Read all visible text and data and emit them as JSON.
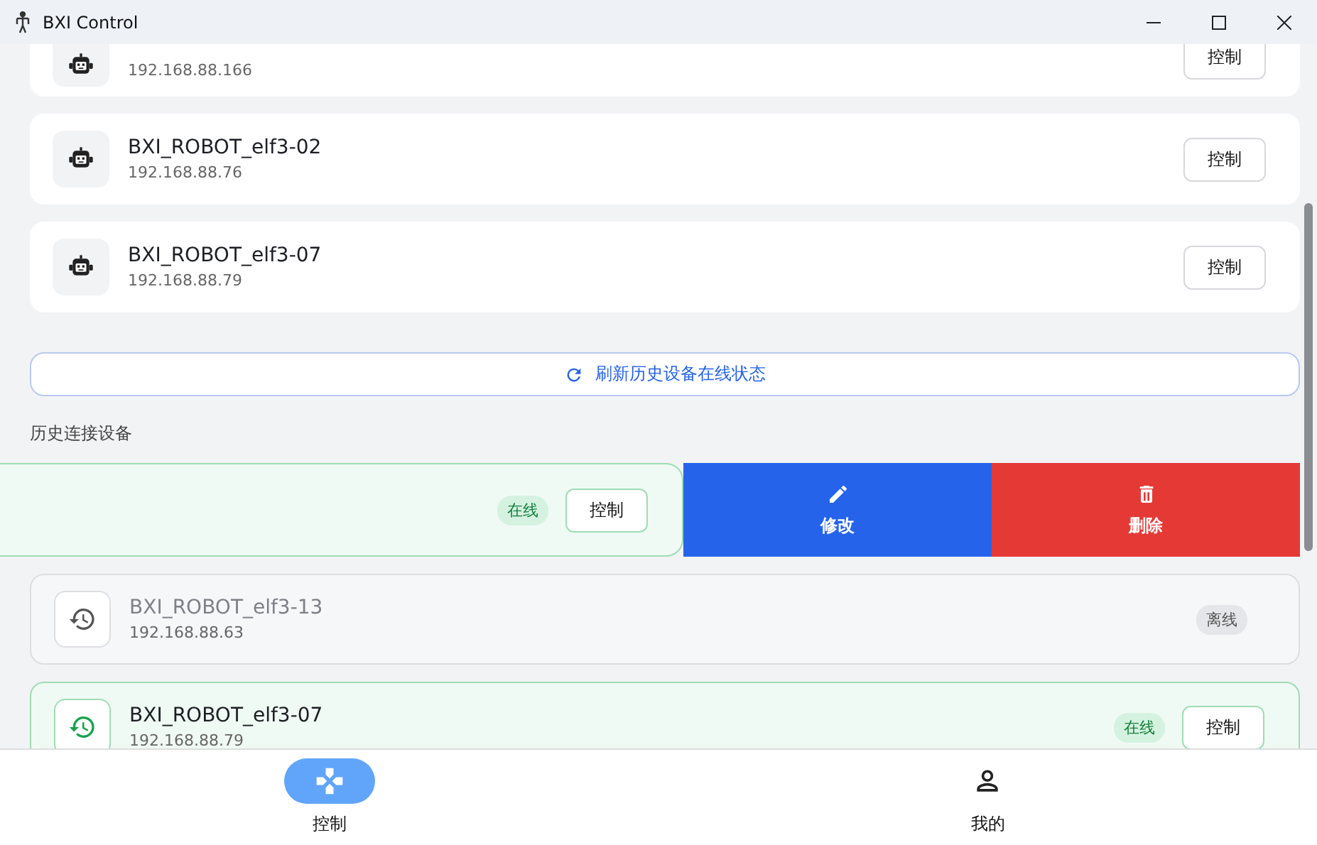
{
  "window": {
    "title": "BXI Control"
  },
  "devices": [
    {
      "ip": "192.168.88.166",
      "button": "控制"
    },
    {
      "name": "BXI_ROBOT_elf3-02",
      "ip": "192.168.88.76",
      "button": "控制"
    },
    {
      "name": "BXI_ROBOT_elf3-07",
      "ip": "192.168.88.79",
      "button": "控制"
    }
  ],
  "refresh_button": "刷新历史设备在线状态",
  "history_title": "历史连接设备",
  "history": [
    {
      "kind": "swiped",
      "online": true,
      "status": "在线",
      "button": "控制",
      "actions": [
        {
          "kind": "edit",
          "label": "修改"
        },
        {
          "kind": "delete",
          "label": "删除"
        }
      ]
    },
    {
      "kind": "row",
      "online": false,
      "name": "BXI_ROBOT_elf3-13",
      "ip": "192.168.88.63",
      "status": "离线"
    },
    {
      "kind": "row",
      "online": true,
      "name": "BXI_ROBOT_elf3-07",
      "ip": "192.168.88.79",
      "status": "在线",
      "button": "控制"
    }
  ],
  "nav": [
    {
      "kind": "gamepad",
      "label": "控制",
      "selected": true
    },
    {
      "kind": "person",
      "label": "我的",
      "selected": false
    }
  ]
}
